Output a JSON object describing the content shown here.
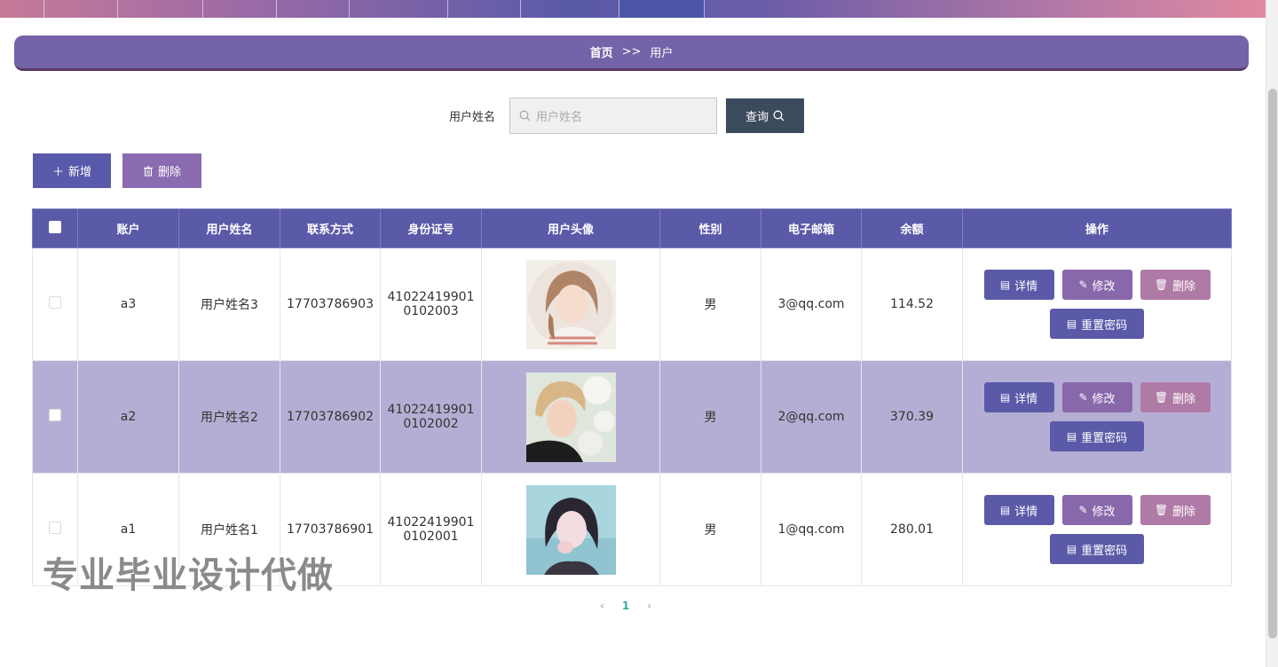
{
  "breadcrumb": {
    "home": "首页",
    "separator": ">>",
    "current": "用户"
  },
  "search": {
    "label": "用户姓名",
    "placeholder": "用户姓名",
    "button_label": "查询"
  },
  "actions": {
    "add_label": "新增",
    "delete_label": "删除"
  },
  "table": {
    "headers": [
      "账户",
      "用户姓名",
      "联系方式",
      "身份证号",
      "用户头像",
      "性别",
      "电子邮箱",
      "余额",
      "操作"
    ],
    "rows": [
      {
        "account": "a3",
        "name": "用户姓名3",
        "phone": "17703786903",
        "id_line1": "41022419901",
        "id_line2": "0102003",
        "gender": "男",
        "email": "3@qq.com",
        "balance": "114.52"
      },
      {
        "account": "a2",
        "name": "用户姓名2",
        "phone": "17703786902",
        "id_line1": "41022419901",
        "id_line2": "0102002",
        "gender": "男",
        "email": "2@qq.com",
        "balance": "370.39"
      },
      {
        "account": "a1",
        "name": "用户姓名1",
        "phone": "17703786901",
        "id_line1": "41022419901",
        "id_line2": "0102001",
        "gender": "男",
        "email": "1@qq.com",
        "balance": "280.01"
      }
    ],
    "row_actions": {
      "detail": "详情",
      "edit": "修改",
      "delete": "删除",
      "reset_password": "重置密码"
    }
  },
  "pagination": {
    "prev": "‹",
    "current": "1",
    "next": "›"
  },
  "watermark": "专业毕业设计代做",
  "colors": {
    "header": "#5b5aa9",
    "row_alt": "#b5aed4",
    "breadcrumb": "#7463a8",
    "search_button": "#3c4a5e"
  }
}
